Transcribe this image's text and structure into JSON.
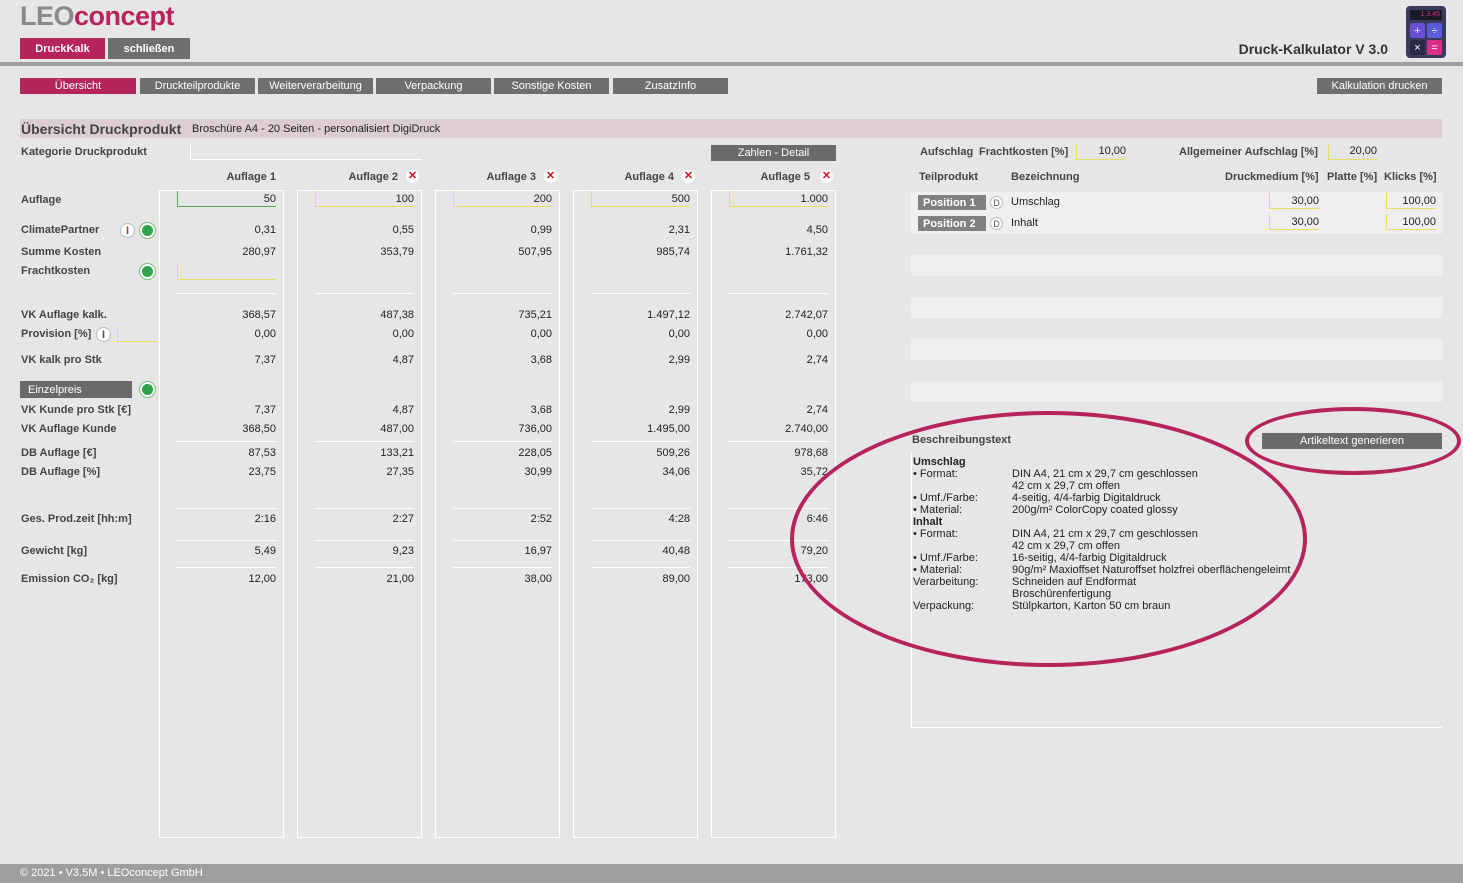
{
  "app": {
    "brand_part1": "LEO",
    "brand_part2": "concept",
    "title": "Druck-Kalkulator V 3.0",
    "btn_druckkalk": "DruckKalk",
    "btn_close": "schließen",
    "calc_display": "1.3.45",
    "footer": "© 2021 • V3.5M • LEOconcept GmbH"
  },
  "colors": {
    "accent": "#b5245a",
    "tab_gray": "#6f6f6f",
    "input_yellow": "#e8e05a",
    "input_green": "#53a653"
  },
  "tabs": [
    "Übersicht",
    "Druckteilprodukte",
    "Weiterverarbeitung",
    "Verpackung",
    "Sonstige Kosten",
    "ZusatzInfo"
  ],
  "print_btn": "Kalkulation drucken",
  "overview": {
    "title": "Übersicht Druckprodukt",
    "product": "Broschüre A4 - 20 Seiten - personalisiert DigiDruck",
    "category_label": "Kategorie Druckprodukt",
    "detail_btn": "Zahlen - Detail",
    "einzelpreis_btn": "Einzelpreis",
    "row_labels": {
      "auflage": "Auflage",
      "climate": "ClimatePartner",
      "summe": "Summe Kosten",
      "fracht": "Frachtkosten",
      "vk_auflage": "VK Auflage kalk.",
      "provision": "Provision [%]",
      "vk_stk": "VK kalk pro Stk",
      "vk_kunde_stk": "VK Kunde pro Stk [€]",
      "vk_auflage_kunde": "VK Auflage Kunde",
      "db_eur": "DB Auflage [€]",
      "db_pct": "DB Auflage [%]",
      "prodzeit": "Ges. Prod.zeit [hh:m]",
      "gewicht": "Gewicht [kg]",
      "emission": "Emission CO₂ [kg]"
    },
    "columns": [
      {
        "head": "Auflage 1",
        "auflage": "50",
        "climate": "0,31",
        "summe": "280,97",
        "vk_auflage": "368,57",
        "provision": "0,00",
        "vk_stk": "7,37",
        "vk_kunde_stk": "7,37",
        "vk_auflage_kunde": "368,50",
        "db_eur": "87,53",
        "db_pct": "23,75",
        "prodzeit": "2:16",
        "gewicht": "5,49",
        "emission": "12,00"
      },
      {
        "head": "Auflage 2",
        "auflage": "100",
        "climate": "0,55",
        "summe": "353,79",
        "vk_auflage": "487,38",
        "provision": "0,00",
        "vk_stk": "4,87",
        "vk_kunde_stk": "4,87",
        "vk_auflage_kunde": "487,00",
        "db_eur": "133,21",
        "db_pct": "27,35",
        "prodzeit": "2:27",
        "gewicht": "9,23",
        "emission": "21,00"
      },
      {
        "head": "Auflage 3",
        "auflage": "200",
        "climate": "0,99",
        "summe": "507,95",
        "vk_auflage": "735,21",
        "provision": "0,00",
        "vk_stk": "3,68",
        "vk_kunde_stk": "3,68",
        "vk_auflage_kunde": "736,00",
        "db_eur": "228,05",
        "db_pct": "30,99",
        "prodzeit": "2:52",
        "gewicht": "16,97",
        "emission": "38,00"
      },
      {
        "head": "Auflage 4",
        "auflage": "500",
        "climate": "2,31",
        "summe": "985,74",
        "vk_auflage": "1.497,12",
        "provision": "0,00",
        "vk_stk": "2,99",
        "vk_kunde_stk": "2,99",
        "vk_auflage_kunde": "1.495,00",
        "db_eur": "509,26",
        "db_pct": "34,06",
        "prodzeit": "4:28",
        "gewicht": "40,48",
        "emission": "89,00"
      },
      {
        "head": "Auflage 5",
        "auflage": "1.000",
        "climate": "4,50",
        "summe": "1.761,32",
        "vk_auflage": "2.742,07",
        "provision": "0,00",
        "vk_stk": "2,74",
        "vk_kunde_stk": "2,74",
        "vk_auflage_kunde": "2.740,00",
        "db_eur": "978,68",
        "db_pct": "35,72",
        "prodzeit": "6:46",
        "gewicht": "79,20",
        "emission": "173,00"
      }
    ]
  },
  "right": {
    "aufschlag_label": "Aufschlag",
    "fracht_label": "Frachtkosten [%]",
    "fracht_value": "10,00",
    "allg_label": "Allgemeiner Aufschlag [%]",
    "allg_value": "20,00",
    "headers": {
      "teil": "Teilprodukt",
      "bez": "Bezeichnung",
      "druck": "Druckmedium [%]",
      "platte": "Platte [%]",
      "klicks": "Klicks [%]"
    },
    "positions": [
      {
        "label": "Position 1",
        "d": "D",
        "name": "Umschlag",
        "druck": "30,00",
        "klicks": "100,00"
      },
      {
        "label": "Position 2",
        "d": "D",
        "name": "Inhalt",
        "druck": "30,00",
        "klicks": "100,00"
      }
    ],
    "desc_title": "Beschreibungstext",
    "gen_btn": "Artikeltext generieren",
    "desc": {
      "h1": "Umschlag",
      "u_format_k": "• Format:",
      "u_format_v1": "DIN A4, 21 cm x 29,7 cm geschlossen",
      "u_format_v2": "42 cm x 29,7 cm offen",
      "u_umf_k": "• Umf./Farbe:",
      "u_umf_v": "4-seitig, 4/4-farbig Digitaldruck",
      "u_mat_k": "• Material:",
      "u_mat_v": "200g/m² ColorCopy coated glossy",
      "h2": "Inhalt",
      "i_format_k": "• Format:",
      "i_format_v1": "DIN A4, 21 cm x 29,7 cm geschlossen",
      "i_format_v2": "42 cm x 29,7 cm offen",
      "i_umf_k": "• Umf./Farbe:",
      "i_umf_v": "16-seitig, 4/4-farbig Digitaldruck",
      "i_mat_k": "• Material:",
      "i_mat_v": "90g/m² Maxioffset Naturoffset holzfrei oberflächengeleimt",
      "verarb_k": "Verarbeitung:",
      "verarb_v1": "Schneiden auf Endformat",
      "verarb_v2": "Broschürenfertigung",
      "verp_k": "Verpackung:",
      "verp_v": "Stülpkarton, Karton 50 cm braun"
    }
  }
}
